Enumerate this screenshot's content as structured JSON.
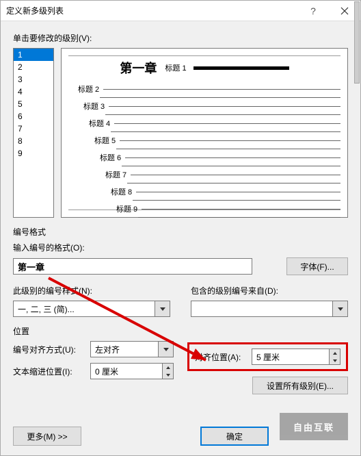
{
  "window": {
    "title": "定义新多级列表"
  },
  "labels": {
    "click_level": "单击要修改的级别(V):",
    "number_format_group": "编号格式",
    "enter_format": "输入编号的格式(O):",
    "font_btn": "字体(F)...",
    "style_label": "此级别的编号样式(N):",
    "include_from": "包含的级别编号来自(D):",
    "position_group": "位置",
    "align_mode": "编号对齐方式(U):",
    "align_at": "对齐位置(A):",
    "text_indent": "文本缩进位置(I):",
    "set_all": "设置所有级别(E)...",
    "more_btn": "更多(M) >>",
    "ok_btn": "确定",
    "cancel_overlay": "自由互联"
  },
  "levels": [
    "1",
    "2",
    "3",
    "4",
    "5",
    "6",
    "7",
    "8",
    "9"
  ],
  "selected_level": "1",
  "format_value": "第一章",
  "style_value": "一, 二, 三 (简)...",
  "include_value": "",
  "align_mode_value": "左对齐",
  "align_at_value": "5 厘米",
  "text_indent_value": "0 厘米",
  "preview": {
    "main_label": "第一章",
    "main_sub": "标题 1",
    "rows": [
      {
        "indent": 8,
        "label": "标题 2"
      },
      {
        "indent": 16,
        "label": "标题 3"
      },
      {
        "indent": 24,
        "label": "标题 4"
      },
      {
        "indent": 32,
        "label": "标题 5"
      },
      {
        "indent": 40,
        "label": "标题 6"
      },
      {
        "indent": 48,
        "label": "标题 7"
      },
      {
        "indent": 56,
        "label": "标题 8"
      },
      {
        "indent": 64,
        "label": "标题 9"
      }
    ]
  }
}
